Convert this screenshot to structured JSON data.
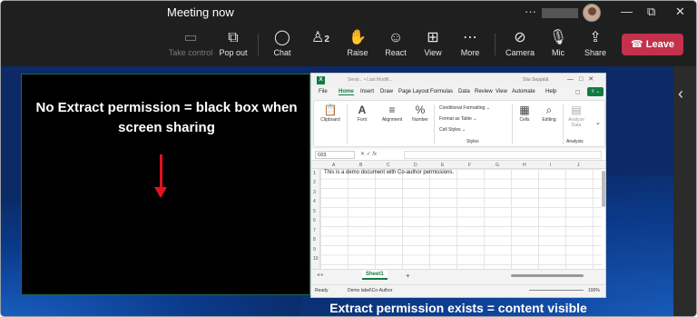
{
  "window": {
    "title": "Meeting now",
    "more_label": "···",
    "min_icon": "minimize-icon",
    "max_icon": "maximize-icon",
    "close_icon": "close-icon"
  },
  "toolbar": {
    "buttons": [
      {
        "label": "Take control",
        "icon": "take-control-icon",
        "disabled": true
      },
      {
        "label": "Pop out",
        "icon": "pop-out-icon"
      },
      {
        "label": "Chat",
        "icon": "chat-icon"
      },
      {
        "label": "People",
        "icon": "people-icon",
        "count": "2"
      },
      {
        "label": "Raise",
        "icon": "raise-hand-icon"
      },
      {
        "label": "React",
        "icon": "react-icon"
      },
      {
        "label": "View",
        "icon": "view-icon"
      },
      {
        "label": "More",
        "icon": "more-icon"
      },
      {
        "label": "Camera",
        "icon": "camera-off-icon"
      },
      {
        "label": "Mic",
        "icon": "mic-off-icon"
      },
      {
        "label": "Share",
        "icon": "share-icon"
      }
    ],
    "leave_label": "Leave",
    "leave_color": "#c4314b"
  },
  "left_share": {
    "caption": "No Extract permission = black box when screen sharing",
    "arrow_color": "#e0141e"
  },
  "right_share": {
    "caption": "Extract permission exists = content visible"
  },
  "excel": {
    "title": "Sensi... • Last Modifi...",
    "user": "Sita Seppälä",
    "tabs": [
      "File",
      "Home",
      "Insert",
      "Draw",
      "Page Layout",
      "Formulas",
      "Data",
      "Review",
      "View",
      "Automate",
      "Help"
    ],
    "active_tab": "Home",
    "ribbon": {
      "clipboard": "Clipboard",
      "font": "Font",
      "alignment": "Alignment",
      "number": "Number",
      "conditional": "Conditional Formatting ⌄",
      "format_table": "Format as Table ⌄",
      "cell_styles": "Cell Styles ⌄",
      "styles": "Styles",
      "cells": "Cells",
      "editing": "Editing",
      "analyze": "Analyze Data",
      "analysis": "Analysis"
    },
    "name_box": "O23",
    "columns": [
      "A",
      "B",
      "C",
      "D",
      "E",
      "F",
      "G",
      "H",
      "I",
      "J"
    ],
    "rows": [
      "1",
      "2",
      "3",
      "4",
      "5",
      "6",
      "7",
      "8",
      "9",
      "10"
    ],
    "cell_text": "This is a demo document with Co-author permissions.",
    "sheet": "Sheet1",
    "status_ready": "Ready",
    "status_label": "Demo label\\Co-Author",
    "zoom": "100%"
  }
}
